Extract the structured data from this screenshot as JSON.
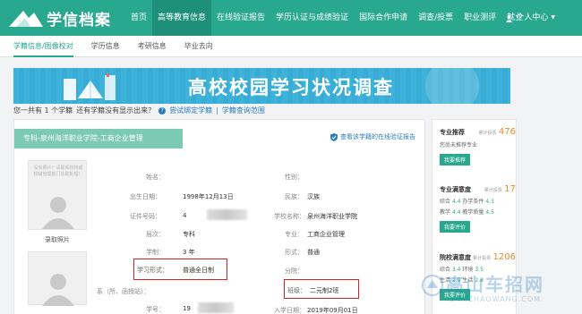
{
  "app": {
    "logo_text": "学信档案"
  },
  "nav": {
    "items": [
      "首页",
      "高等教育信息",
      "在线验证报告",
      "学历认证与成绩验证",
      "国际合作申请",
      "调查/投票",
      "职业测评",
      "就业"
    ],
    "active_index": 1,
    "user_label": "个人中心"
  },
  "subnav": {
    "items": [
      "学籍信息/图像校对",
      "学历信息",
      "考研信息",
      "毕业去向"
    ],
    "active_index": 0
  },
  "banner": {
    "title": "高校校园学习状况调查"
  },
  "infoline": {
    "count_text": "您一共有 1 个学籍",
    "question": "还有学籍没有显示出来？",
    "bind_link": "尝试绑定学籍",
    "divider": "|",
    "scope_link": "学籍查询范围"
  },
  "record": {
    "tab_label": "专科-泉州海洋职业学院-工商企业管理",
    "verify_link": "查看该学籍的在线验证报告",
    "photo_note": "没有照片？请联系院校或校级管理部门协助处理！",
    "photo_label": "录取照片",
    "left_fields": [
      {
        "label": "姓名：",
        "value": ""
      },
      {
        "label": "出生日期：",
        "value": "1998年12月13日"
      },
      {
        "label": "证件号码：",
        "value": "4"
      },
      {
        "label": "层次：",
        "value": "专科"
      },
      {
        "label": "学制：",
        "value": "3 年"
      },
      {
        "label": "学习形式：",
        "value": "普通全日制"
      },
      {
        "label": "系（所、函授站）：",
        "value": ""
      },
      {
        "label": "学号：",
        "value": "19"
      }
    ],
    "right_fields": [
      {
        "label": "性别：",
        "value": ""
      },
      {
        "label": "民族：",
        "value": "汉族"
      },
      {
        "label": "学校名称：",
        "value": "泉州海洋职业学院"
      },
      {
        "label": "专业：",
        "value": "工商企业管理"
      },
      {
        "label": "形式：",
        "value": "普通"
      },
      {
        "label": "分院：",
        "value": ""
      },
      {
        "label": "班级：",
        "value": "二元制2班"
      },
      {
        "label": "入学日期：",
        "value": "2019年09月01日"
      }
    ]
  },
  "side": {
    "rec": {
      "title": "专业推荐",
      "count_label": "累计投票",
      "count": "476",
      "text": "您尚未推荐专业",
      "button": "我要推荐"
    },
    "sat": {
      "title": "专业满意度",
      "count_label": "累计投票",
      "count": "17",
      "rows": [
        {
          "a_label": "综合",
          "a_val": "4.4",
          "b_label": "办学条件",
          "b_val": "4.3"
        },
        {
          "a_label": "教学",
          "a_val": "4.4",
          "b_label": "教学质量",
          "b_val": "4.5"
        }
      ],
      "button": "我要评价"
    },
    "school": {
      "title": "院校满意度",
      "count_label": "累计投票",
      "count": "1206",
      "rows": [
        {
          "a_label": "综合",
          "a_val": "3.4",
          "b_label": "环境",
          "b_val": "3.5"
        },
        {
          "a_label": "生活",
          "a_val": "2.9",
          "b_label": "生活",
          "b_val": "2.8"
        }
      ],
      "button": "我要评价"
    }
  },
  "watermark": {
    "main": "高山车招网",
    "sub": "DANZHAOWANG.COM"
  },
  "colors": {
    "brand": "#27a88f",
    "banner": "#3bb0d8",
    "highlight": "#e02020",
    "link": "#2a7ec0",
    "accent": "#e78d2b"
  }
}
